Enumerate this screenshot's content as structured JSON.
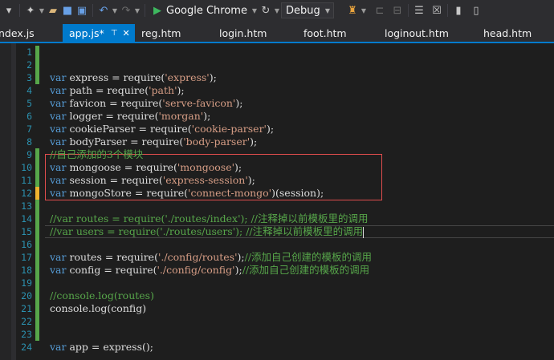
{
  "toolbar": {
    "browser": "Google Chrome",
    "config": "Debug"
  },
  "tabs": [
    {
      "label": "ndex.js"
    },
    {
      "label": "app.js*",
      "active": true
    },
    {
      "label": "reg.htm"
    },
    {
      "label": "login.htm"
    },
    {
      "label": "foot.htm"
    },
    {
      "label": "loginout.htm"
    },
    {
      "label": "head.htm"
    }
  ],
  "editor": {
    "lines": [
      {
        "n": "1",
        "change": "green",
        "tokens": []
      },
      {
        "n": "2",
        "change": "green",
        "tokens": []
      },
      {
        "n": "3",
        "change": "green",
        "tokens": [
          {
            "t": "var",
            "c": "kw"
          },
          {
            "t": " express = require("
          },
          {
            "t": "'express'",
            "c": "str"
          },
          {
            "t": ");"
          }
        ]
      },
      {
        "n": "4",
        "tokens": [
          {
            "t": "var",
            "c": "kw"
          },
          {
            "t": " path = require("
          },
          {
            "t": "'path'",
            "c": "str"
          },
          {
            "t": ");"
          }
        ]
      },
      {
        "n": "5",
        "tokens": [
          {
            "t": "var",
            "c": "kw"
          },
          {
            "t": " favicon = require("
          },
          {
            "t": "'serve-favicon'",
            "c": "str"
          },
          {
            "t": ");"
          }
        ]
      },
      {
        "n": "6",
        "tokens": [
          {
            "t": "var",
            "c": "kw"
          },
          {
            "t": " logger = require("
          },
          {
            "t": "'morgan'",
            "c": "str"
          },
          {
            "t": ");"
          }
        ]
      },
      {
        "n": "7",
        "tokens": [
          {
            "t": "var",
            "c": "kw"
          },
          {
            "t": " cookieParser = require("
          },
          {
            "t": "'cookie-parser'",
            "c": "str"
          },
          {
            "t": ");"
          }
        ]
      },
      {
        "n": "8",
        "tokens": [
          {
            "t": "var",
            "c": "kw"
          },
          {
            "t": " bodyParser = require("
          },
          {
            "t": "'body-parser'",
            "c": "str"
          },
          {
            "t": ");"
          }
        ]
      },
      {
        "n": "9",
        "change": "green",
        "tokens": [
          {
            "t": "//自己添加的3个模块",
            "c": "cm"
          }
        ]
      },
      {
        "n": "10",
        "change": "green",
        "tokens": [
          {
            "t": "var",
            "c": "kw"
          },
          {
            "t": " mongoose = require("
          },
          {
            "t": "'mongoose'",
            "c": "str"
          },
          {
            "t": ");"
          }
        ]
      },
      {
        "n": "11",
        "change": "green",
        "tokens": [
          {
            "t": "var",
            "c": "kw"
          },
          {
            "t": " session = require("
          },
          {
            "t": "'express-session'",
            "c": "str"
          },
          {
            "t": ");"
          }
        ]
      },
      {
        "n": "12",
        "change": "yellow",
        "tokens": [
          {
            "t": "var",
            "c": "kw"
          },
          {
            "t": " mongoStore = require("
          },
          {
            "t": "'connect-mongo'",
            "c": "str"
          },
          {
            "t": ")(session);"
          }
        ]
      },
      {
        "n": "13",
        "change": "green",
        "tokens": []
      },
      {
        "n": "14",
        "change": "green",
        "tokens": [
          {
            "t": "//var routes = require('./routes/index'); //注释掉以前模板里的调用",
            "c": "cm"
          }
        ]
      },
      {
        "n": "15",
        "change": "green",
        "current": true,
        "tokens": [
          {
            "t": "//var users = require('./routes/users'); //注释掉以前模板里的调用",
            "c": "cm"
          }
        ]
      },
      {
        "n": "16",
        "change": "green",
        "tokens": []
      },
      {
        "n": "17",
        "change": "green",
        "tokens": [
          {
            "t": "var",
            "c": "kw"
          },
          {
            "t": " routes = require("
          },
          {
            "t": "'./config/routes'",
            "c": "str"
          },
          {
            "t": ");"
          },
          {
            "t": "//添加自己创建的模板的调用",
            "c": "cm"
          }
        ]
      },
      {
        "n": "18",
        "change": "green",
        "tokens": [
          {
            "t": "var",
            "c": "kw"
          },
          {
            "t": " config = require("
          },
          {
            "t": "'./config/config'",
            "c": "str"
          },
          {
            "t": ");"
          },
          {
            "t": "//添加自己创建的模板的调用",
            "c": "cm"
          }
        ]
      },
      {
        "n": "19",
        "change": "green",
        "tokens": []
      },
      {
        "n": "20",
        "change": "green",
        "tokens": [
          {
            "t": "//console.log(routes)",
            "c": "cm"
          }
        ]
      },
      {
        "n": "21",
        "change": "green",
        "tokens": [
          {
            "t": "console.log(config)"
          }
        ]
      },
      {
        "n": "22",
        "change": "green",
        "tokens": []
      },
      {
        "n": "23",
        "change": "green",
        "tokens": []
      },
      {
        "n": "24",
        "tokens": [
          {
            "t": "var",
            "c": "kw"
          },
          {
            "t": " app = express();"
          }
        ]
      }
    ]
  },
  "colors": {
    "accent": "#007acc",
    "keyword": "#569cd6",
    "string": "#d69d85",
    "comment": "#57a64a",
    "highlight_box": "#e04d4d"
  }
}
